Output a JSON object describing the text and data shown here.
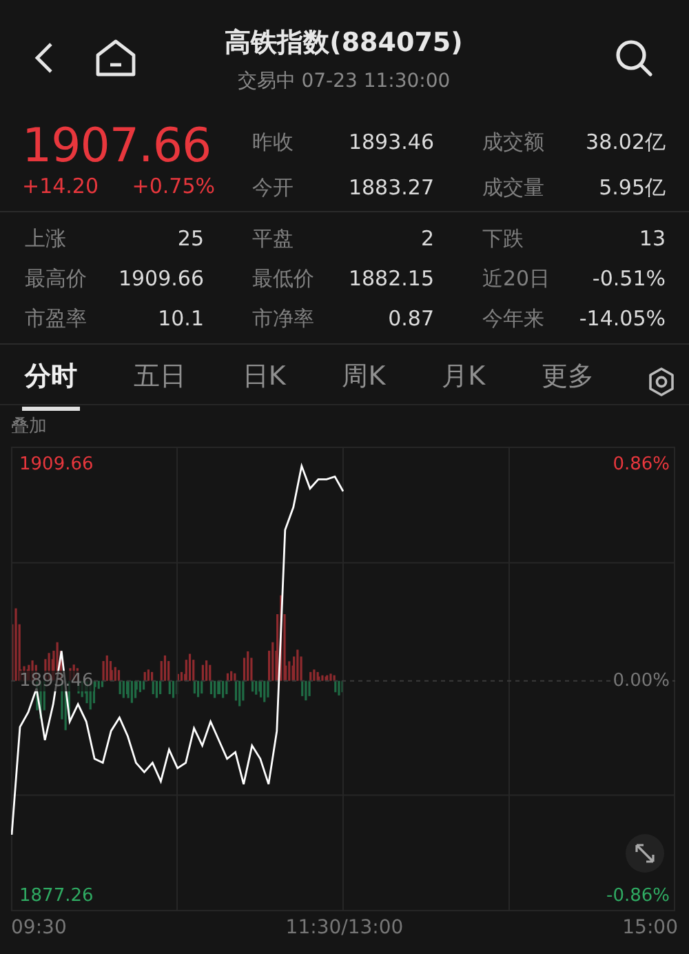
{
  "header": {
    "title": "高铁指数(884075)",
    "status": "交易中 07-23 11:30:00"
  },
  "quote": {
    "price": "1907.66",
    "change": "+14.20",
    "change_pct": "+0.75%"
  },
  "stats_top": [
    {
      "label": "昨收",
      "value": "1893.46"
    },
    {
      "label": "成交额",
      "value": "38.02亿"
    },
    {
      "label": "今开",
      "value": "1883.27"
    },
    {
      "label": "成交量",
      "value": "5.95亿"
    }
  ],
  "stats": [
    {
      "label": "上涨",
      "value": "25"
    },
    {
      "label": "平盘",
      "value": "2"
    },
    {
      "label": "下跌",
      "value": "13"
    },
    {
      "label": "最高价",
      "value": "1909.66"
    },
    {
      "label": "最低价",
      "value": "1882.15"
    },
    {
      "label": "近20日",
      "value": "-0.51%"
    },
    {
      "label": "市盈率",
      "value": "10.1"
    },
    {
      "label": "市净率",
      "value": "0.87"
    },
    {
      "label": "今年来",
      "value": "-14.05%"
    }
  ],
  "tabs": [
    {
      "label": "分时",
      "selected": true
    },
    {
      "label": "五日",
      "selected": false
    },
    {
      "label": "日K",
      "selected": false
    },
    {
      "label": "周K",
      "selected": false
    },
    {
      "label": "月K",
      "selected": false
    },
    {
      "label": "更多",
      "selected": false
    }
  ],
  "overlay_label": "叠加",
  "chart": {
    "pct_ticks": [
      "0.86%",
      "0.00%",
      "-0.86%"
    ],
    "time_labels": [
      "09:30",
      "11:30/13:00",
      "15:00"
    ],
    "chart_data": {
      "type": "line",
      "categories": [
        null,
        null,
        null,
        null,
        null,
        null,
        null,
        null,
        null,
        null,
        null,
        null,
        null,
        null,
        null,
        null,
        null,
        null,
        null,
        null,
        null,
        null,
        null,
        null,
        null,
        null,
        null,
        null,
        null,
        null,
        null,
        null,
        null,
        null,
        null,
        null,
        null,
        null,
        null,
        null,
        null,
        null,
        null,
        null,
        null,
        null,
        null,
        null,
        null,
        null,
        null,
        null,
        null,
        null,
        null,
        null,
        null,
        null,
        null,
        null,
        null,
        null,
        null,
        null,
        null,
        null,
        null,
        null,
        null,
        null,
        null,
        null,
        null,
        null,
        null,
        null,
        null,
        null,
        null,
        null,
        null
      ],
      "series": [
        {
          "color": "#ffffff",
          "values": [
            1881.9,
            1890.0,
            1891.1,
            1892.9,
            1889.0,
            1891.7,
            1895.7,
            1890.4,
            1891.7,
            1890.4,
            1887.6,
            1887.3,
            1889.7,
            1890.7,
            1889.3,
            1887.3,
            1886.6,
            1887.3,
            1885.9,
            1888.3,
            1886.9,
            1887.3,
            1889.9,
            1888.6,
            1890.4,
            1889.0,
            1887.6,
            1888.1,
            1885.7,
            1888.6,
            1887.6,
            1885.7,
            1889.7,
            1904.8,
            1906.5,
            1909.6,
            1907.9,
            1908.6,
            1908.6,
            1908.8,
            1907.7,
            null,
            null,
            null,
            null,
            null,
            null,
            null,
            null,
            null,
            null,
            null,
            null,
            null,
            null,
            null,
            null,
            null,
            null,
            null,
            null,
            null,
            null,
            null,
            null,
            null,
            null,
            null,
            null,
            null,
            null,
            null,
            null,
            null,
            null,
            null,
            null,
            null,
            null,
            null,
            null
          ]
        }
      ],
      "ylim": [
        1876.2,
        1911.0
      ],
      "ref_lines": [
        {
          "axis": "y",
          "value": 1893.46
        }
      ],
      "yticks": [
        {
          "value": 1909.66,
          "label": "1909.66"
        },
        {
          "value": 1893.46,
          "label": "1893.46"
        },
        {
          "value": 1877.26,
          "label": "1877.26"
        }
      ]
    }
  }
}
